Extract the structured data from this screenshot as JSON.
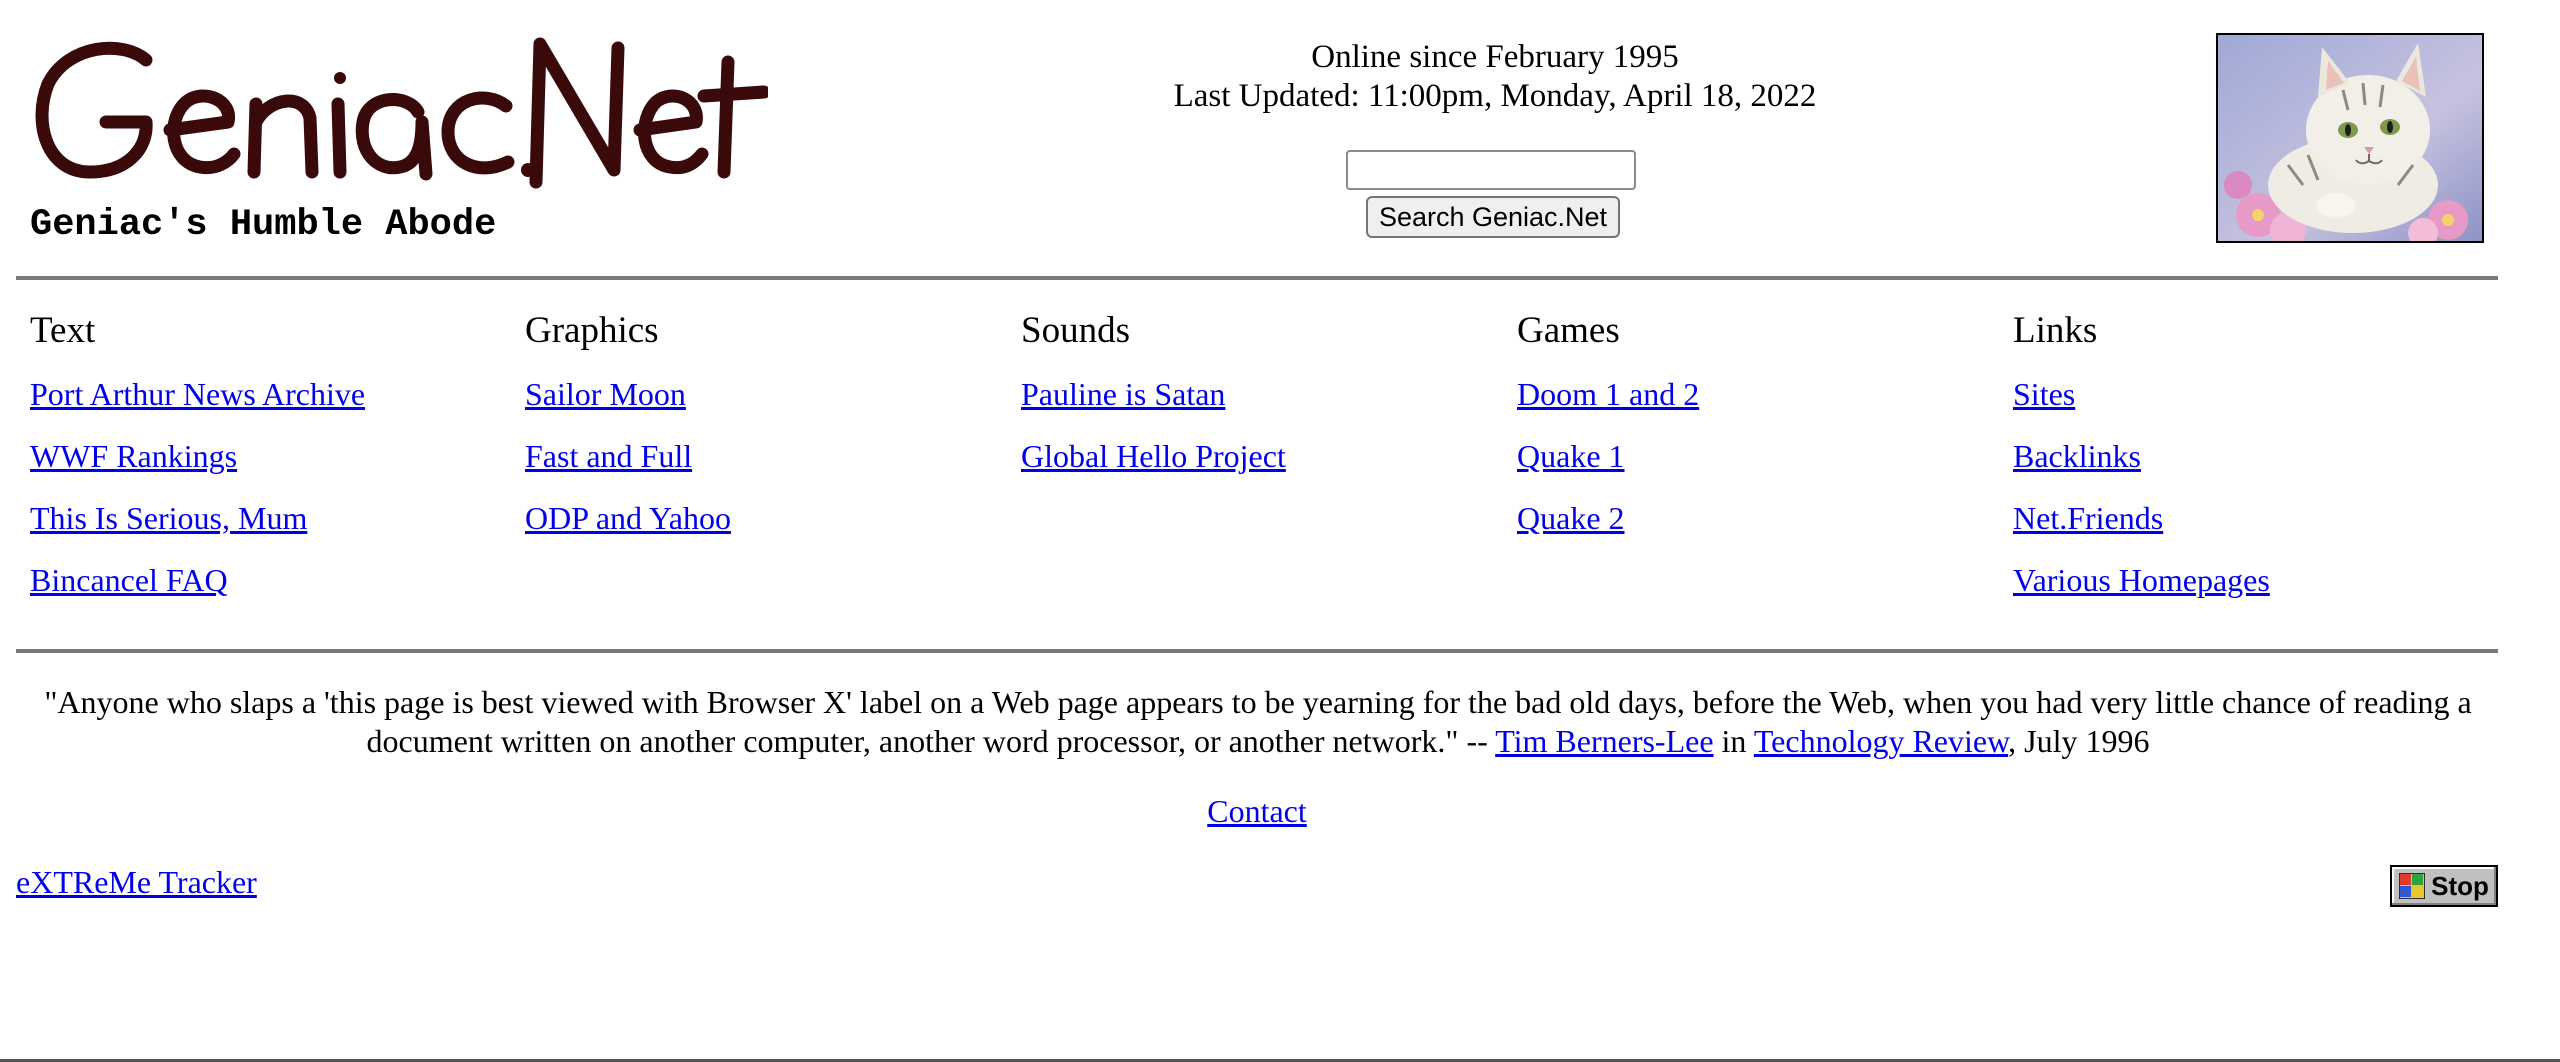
{
  "header": {
    "logo_text": "Geniac.Net",
    "tagline": "Geniac's Humble Abode",
    "online_since": "Online since February 1995",
    "last_updated": "Last Updated: 11:00pm, Monday, April 18, 2022",
    "search": {
      "value": "",
      "button_label": "Search Geniac.Net"
    },
    "image_icon": "kitten-painting"
  },
  "nav": {
    "columns": [
      {
        "heading": "Text",
        "links": [
          "Port Arthur News Archive",
          "WWF Rankings",
          "This Is Serious, Mum",
          "Bincancel FAQ"
        ]
      },
      {
        "heading": "Graphics",
        "links": [
          "Sailor Moon",
          "Fast and Full",
          "ODP and Yahoo"
        ]
      },
      {
        "heading": "Sounds",
        "links": [
          "Pauline is Satan",
          "Global Hello Project"
        ]
      },
      {
        "heading": "Games",
        "links": [
          "Doom 1 and 2",
          "Quake 1",
          "Quake 2"
        ]
      },
      {
        "heading": "Links",
        "links": [
          "Sites",
          "Backlinks",
          "Net.Friends",
          "Various Homepages"
        ]
      }
    ]
  },
  "quote": {
    "text": "\"Anyone who slaps a 'this page is best viewed with Browser X' label on a Web page appears to be yearning for the bad old days, before the Web, when you had very little chance of reading a document written on another computer, another word processor, or another network.\" --",
    "author_link": "Tim Berners-Lee",
    "in_word": "in",
    "source_link": "Technology Review",
    "date": ", July 1996"
  },
  "footer": {
    "contact_link": "Contact",
    "tracker_link": "eXTReMe Tracker",
    "stop_label": "Stop",
    "stop_icon": "stop-flag-icon"
  },
  "colors": {
    "link": "#0000ee",
    "logo": "#3a0a0a",
    "rule": "#7a7a7a"
  }
}
